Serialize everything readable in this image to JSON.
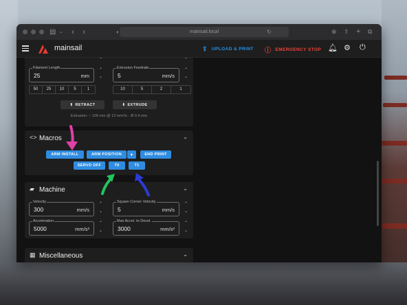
{
  "browser": {
    "url": "mainsail.local"
  },
  "app": {
    "brand": "mainsail",
    "upload_label": "UPLOAD & PRINT",
    "estop_label": "EMERGENCY STOP"
  },
  "extruder": {
    "filament_length": {
      "label": "Filament Length",
      "value": "25",
      "unit": "mm"
    },
    "feedrate": {
      "label": "Extrusion Feedrate",
      "value": "5",
      "unit": "mm/s"
    },
    "length_presets": [
      "50",
      "25",
      "10",
      "5",
      "1"
    ],
    "feedrate_presets": [
      "10",
      "5",
      "2",
      "1"
    ],
    "retract_label": "RETRACT",
    "extrude_label": "EXTRUDE",
    "info": "Extrusion: ~ 109 mm @ 12 mm³/s - Ø 0.4 mm"
  },
  "macros": {
    "title": "Macros",
    "buttons": {
      "arm_install": "ARM INSTALL",
      "arm_position": "ARM POSITION",
      "end_print": "END PRINT",
      "servo_off": "SERVO OFF",
      "t0": "T0",
      "t1": "T1"
    }
  },
  "machine": {
    "title": "Machine",
    "velocity": {
      "label": "Velocity",
      "value": "300",
      "unit": "mm/s"
    },
    "scv": {
      "label": "Square Corner Velocity",
      "value": "5",
      "unit": "mm/s"
    },
    "acceleration": {
      "label": "Acceleration",
      "value": "5000",
      "unit": "mm/s²"
    },
    "accel_to_decel": {
      "label": "Max Accel. to Decel.",
      "value": "3000",
      "unit": "mm/s²"
    }
  },
  "misc": {
    "title": "Miscellaneous"
  },
  "annotation_colors": {
    "pink": "#e040a8",
    "green": "#22c55e",
    "blue": "#2d3bd6",
    "accent": "#2f8ce0",
    "danger": "#f44336"
  }
}
